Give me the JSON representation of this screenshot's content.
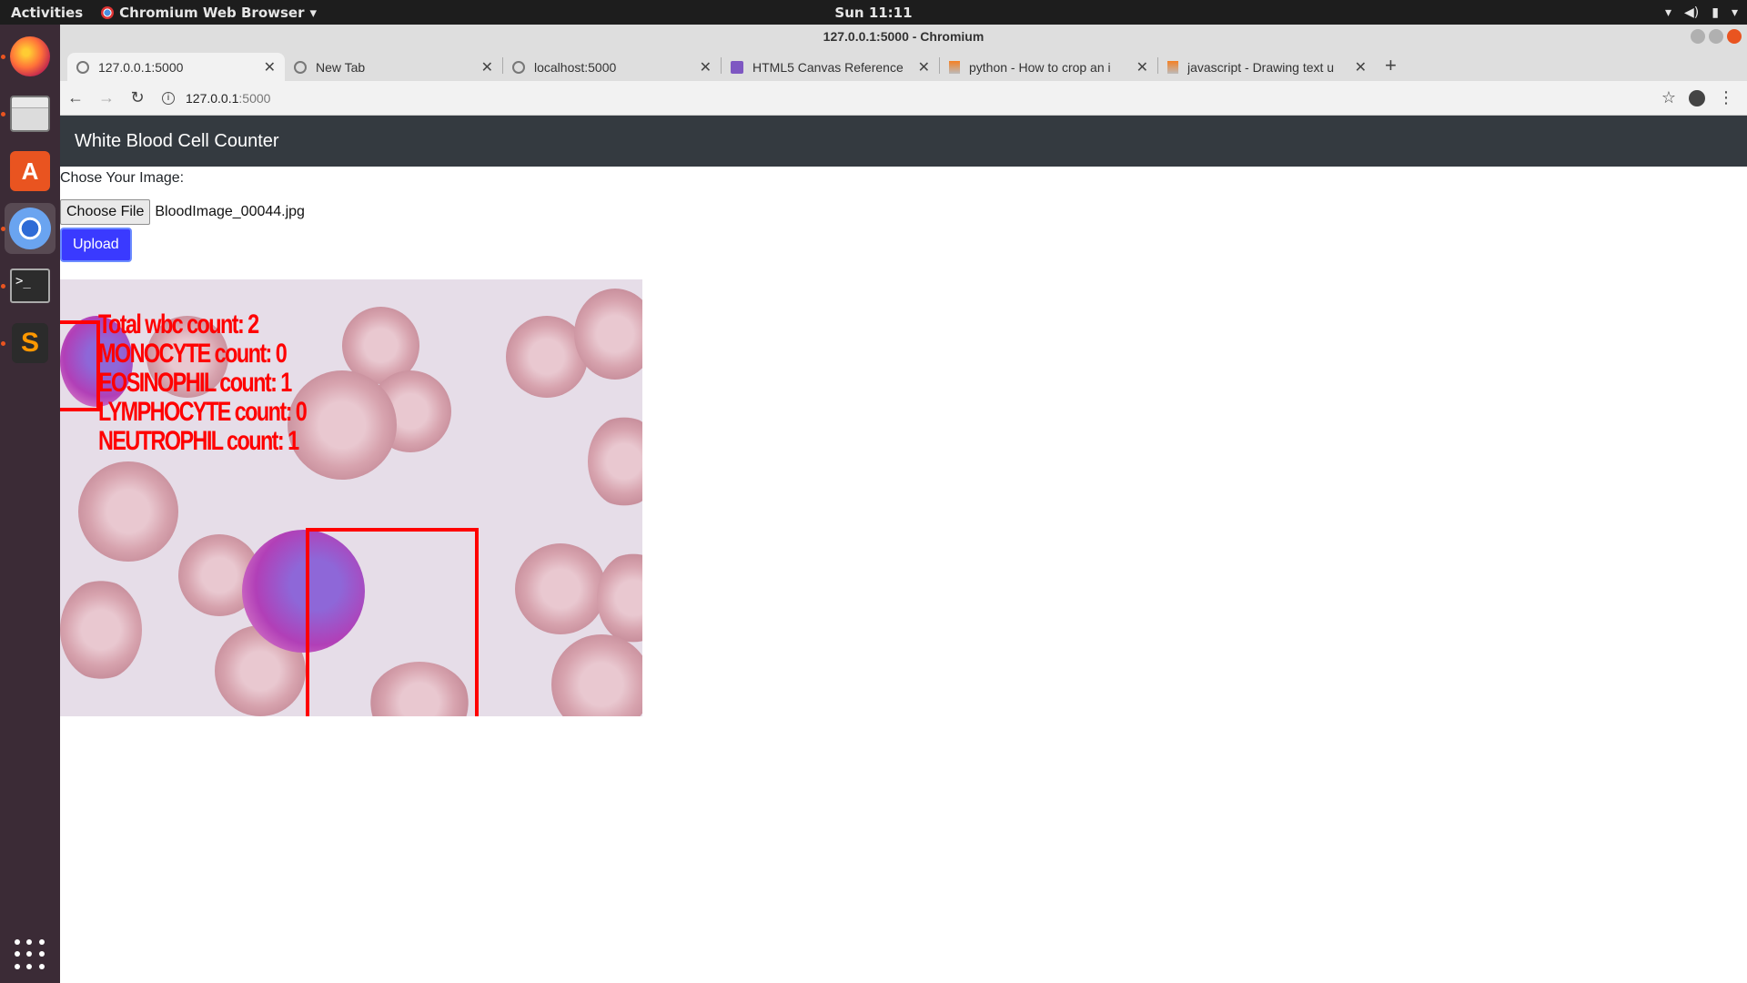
{
  "topbar": {
    "activities": "Activities",
    "app_menu": "Chromium Web Browser",
    "clock": "Sun 11:11"
  },
  "dock": {
    "items": [
      "firefox-icon",
      "files-icon",
      "software-center-icon",
      "chromium-icon",
      "terminal-icon",
      "sublime-text-icon",
      "show-apps-icon"
    ]
  },
  "window": {
    "title": "127.0.0.1:5000 - Chromium"
  },
  "tabs": [
    {
      "title": "127.0.0.1:5000",
      "active": true
    },
    {
      "title": "New Tab",
      "active": false
    },
    {
      "title": "localhost:5000",
      "active": false
    },
    {
      "title": "HTML5 Canvas Reference",
      "active": false
    },
    {
      "title": "python - How to crop an i",
      "active": false
    },
    {
      "title": "javascript - Drawing text u",
      "active": false
    }
  ],
  "omnibox": {
    "host": "127.0.0.1",
    "port": ":5000"
  },
  "page": {
    "navbar_title": "White Blood Cell Counter",
    "choose_label": "Chose Your Image:",
    "choose_button": "Choose File",
    "file_name": "BloodImage_00044.jpg",
    "upload_button": "Upload",
    "counts": {
      "total": "Total wbc count: 2",
      "monocyte": "MONOCYTE count: 0",
      "eosinophil": "EOSINOPHIL count: 1",
      "lymphocyte": "LYMPHOCYTE count: 0",
      "neutrophil": "NEUTROPHIL count: 1"
    }
  },
  "colors": {
    "navbar": "#343a40",
    "upload_button": "#3a3aff",
    "annotation": "#ff0000"
  }
}
